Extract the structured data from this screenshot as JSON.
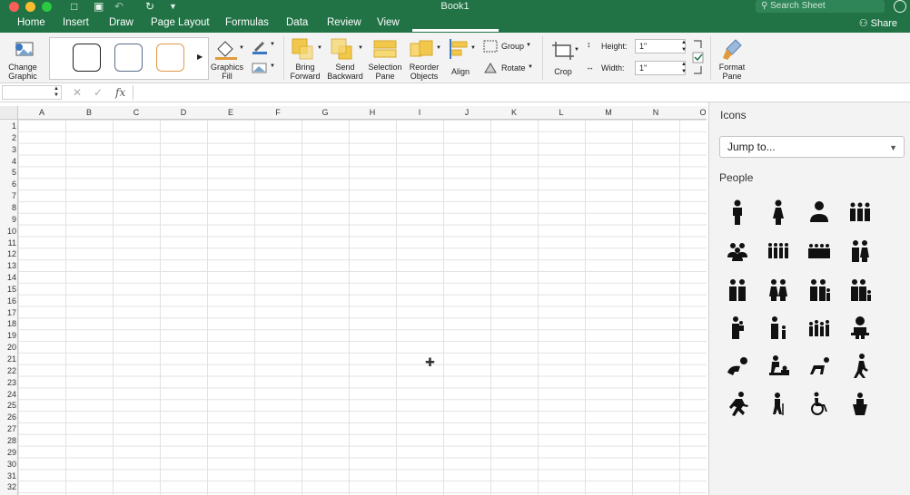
{
  "window": {
    "title": "Book1",
    "search_placeholder": "Search Sheet"
  },
  "tabs": [
    {
      "label": "Home"
    },
    {
      "label": "Insert"
    },
    {
      "label": "Draw"
    },
    {
      "label": "Page Layout"
    },
    {
      "label": "Formulas"
    },
    {
      "label": "Data"
    },
    {
      "label": "Review"
    },
    {
      "label": "View"
    }
  ],
  "share_label": "Share",
  "ribbon": {
    "change_graphic": [
      "Change",
      "Graphic"
    ],
    "graphics_fill": [
      "Graphics",
      "Fill"
    ],
    "bring_forward": [
      "Bring",
      "Forward"
    ],
    "send_backward": [
      "Send",
      "Backward"
    ],
    "selection_pane": [
      "Selection",
      "Pane"
    ],
    "reorder_objects": [
      "Reorder",
      "Objects"
    ],
    "align": "Align",
    "group": "Group",
    "rotate": "Rotate",
    "crop": "Crop",
    "height_label": "Height:",
    "width_label": "Width:",
    "height_value": "1\"",
    "width_value": "1\"",
    "format_pane": [
      "Format",
      "Pane"
    ]
  },
  "formula_bar": {
    "fx": "fx"
  },
  "columns": [
    "A",
    "B",
    "C",
    "D",
    "E",
    "F",
    "G",
    "H",
    "I",
    "J",
    "K",
    "L",
    "M",
    "N",
    "O"
  ],
  "rows": [
    "1",
    "2",
    "3",
    "4",
    "5",
    "6",
    "7",
    "8",
    "9",
    "10",
    "11",
    "12",
    "13",
    "14",
    "15",
    "16",
    "17",
    "18",
    "19",
    "20",
    "21",
    "22",
    "23",
    "24",
    "25",
    "26",
    "27",
    "28",
    "29",
    "30",
    "31",
    "32"
  ],
  "icons_pane": {
    "title": "Icons",
    "jump_label": "Jump to...",
    "section": "People",
    "icons": [
      "man-icon",
      "woman-icon",
      "user-icon",
      "group-of-three-icon",
      "meeting-icon",
      "group-of-four-icon",
      "crowd-icon",
      "couple-icon",
      "two-men-icon",
      "two-women-icon",
      "family-icon",
      "family-with-child-icon",
      "parent-holding-child-icon",
      "parent-with-child-icon",
      "family-of-four-icon",
      "baby-icon",
      "crawling-baby-icon",
      "diaper-change-icon",
      "crawling-person-icon",
      "walking-person-icon",
      "running-person-icon",
      "elderly-person-icon",
      "wheelchair-icon",
      "person-at-podium-icon"
    ]
  },
  "colors": {
    "accent": "#217346",
    "ribbon_bg": "#f3f3f3"
  }
}
